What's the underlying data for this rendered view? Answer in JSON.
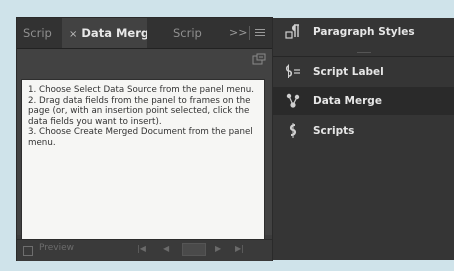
{
  "tabs": [
    {
      "label": "Scrip",
      "active": false
    },
    {
      "close_glyph": "×",
      "label": "Data Merge",
      "active": true
    },
    {
      "label": "Scrip",
      "active": false
    }
  ],
  "tab_overflow": ">>",
  "instructions": [
    "1. Choose Select Data Source from the panel menu.",
    "2. Drag data fields from the panel to frames on the page (or, with an insertion point selected, click the data fields you want to insert).",
    "3. Choose Create Merged Document from the panel menu."
  ],
  "bottom_bar": {
    "preview_label": "Preview",
    "first": "|◀",
    "prev": "◀",
    "next": "▶",
    "last": "▶|"
  },
  "right_panels": [
    {
      "label": "Paragraph Styles",
      "icon": "paragraph-styles-icon",
      "selected": false
    },
    {
      "label": "Script Label",
      "icon": "script-label-icon",
      "selected": false
    },
    {
      "label": "Data Merge",
      "icon": "data-merge-icon",
      "selected": true
    },
    {
      "label": "Scripts",
      "icon": "scripts-icon",
      "selected": false
    }
  ]
}
